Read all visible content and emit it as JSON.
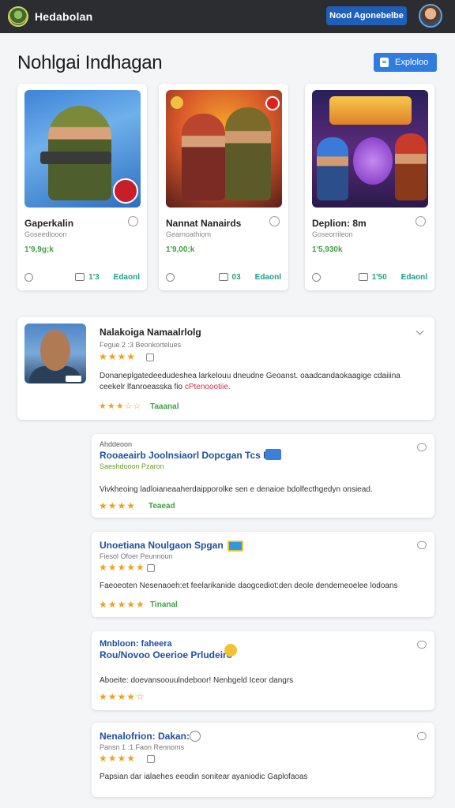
{
  "topbar": {
    "brand": "Hedabolan",
    "cta_label": "Nood Agonebelbe"
  },
  "header": {
    "title": "Nohlgai Indhagan",
    "button_label": "Exploloo"
  },
  "games": [
    {
      "title": "Gaperkalin",
      "subtitle": "Goseedlooon",
      "price": "1'9,9g;k",
      "count": "1'3",
      "action": "Edaonl"
    },
    {
      "title": "Nannat Nanairds",
      "subtitle": "Gearnoathiom",
      "price": "1'9,00;k",
      "count": "03",
      "action": "Edaonl"
    },
    {
      "title": "Deplion: 8m",
      "subtitle": "Goseorrileon",
      "price": "1'5,930k",
      "count": "1'50",
      "action": "Edaonl"
    }
  ],
  "featured_review": {
    "name": "Nalakoiga Namaalrlolg",
    "meta": "Fegue 2 :3 Beonkortelues",
    "stars": "★★★★",
    "text_line1": "Donaneplgatedeedudeshea larkelouu dneudne Geoanst. oaadcandaokaagige cdaiiina",
    "text_line2": "ceekelr lfanroeasska fio",
    "text_highlight": "cPtenoootiie.",
    "sub_stars": "★★★☆☆",
    "tag": "Taaanal"
  },
  "reviews": [
    {
      "kicker": "Ahddeoon",
      "name": "Rooaeairb Joolnsiaorl Dopcgan Tcs Ela:",
      "meta": "Saeshdooon Pzaron",
      "text": "Vivkheoing ladloianeaaherdaipporolke sen e denaioe bdolfecthgedyn onsiead.",
      "stars": "★★★★",
      "tag": "Teaead"
    },
    {
      "name": "Unoetiana Noulgaon Spgan",
      "meta": "Fiesol Ofoer Peunnoun",
      "text": "Faeoeoten Nesenaoeh:et feelarikanide daogcediot:den deole dendemeoelee lodoans",
      "stars": "★★★★★",
      "tag": "Tinanal"
    },
    {
      "kicker": "Mnbloon: faheera",
      "name": "Rou/Novoo Oeerioe Prludeiro",
      "meta": "",
      "text": "Aboeite: doevansoouulndeboor! Nenbgeld Iceor dangrs",
      "stars": "★★★★☆",
      "tag": ""
    },
    {
      "name": "Nenalofrion: Dakan:",
      "meta": "Pansn 1 :1 Faon Rennoms",
      "text": "Papsian dar ialaehes eeodin sonitear ayaniodic Gaplofaoas",
      "stars": "★★★★",
      "tag": ""
    }
  ],
  "colors": {
    "topbar_bg": "#2b2d31",
    "accent_blue": "#1f5fb8",
    "price_green": "#43a047",
    "star_gold": "#f0a020",
    "link_blue": "#1f4fa0"
  }
}
